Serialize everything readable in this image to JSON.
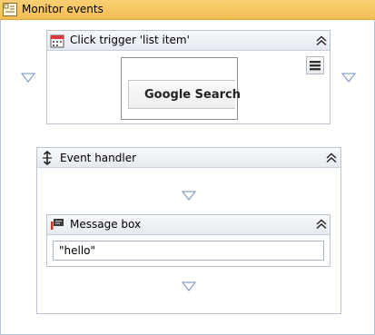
{
  "outer": {
    "title": "Monitor events",
    "icon": "monitor-events-icon"
  },
  "click_trigger": {
    "title": "Click trigger 'list item'",
    "icon": "calendar-trigger-icon",
    "preview_button_label": "Google Search",
    "menu_icon": "hamburger-menu-icon"
  },
  "event_handler": {
    "title": "Event handler",
    "icon": "event-handler-icon"
  },
  "message_box": {
    "title": "Message box",
    "icon": "message-box-icon",
    "text_value": "\"hello\""
  },
  "colors": {
    "header_accent": "#f3bf52",
    "border": "#b8c3cf",
    "triangle": "#6f8fb5"
  }
}
